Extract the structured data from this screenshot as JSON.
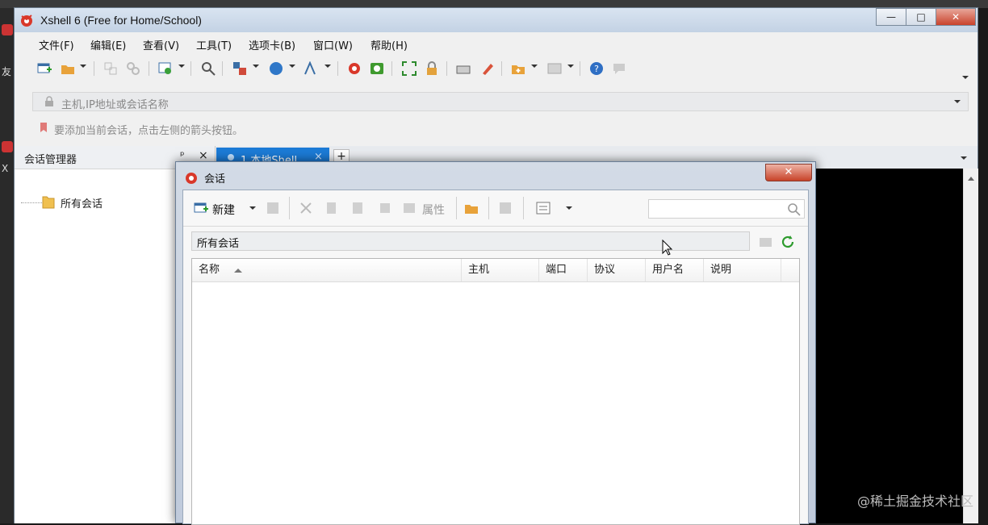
{
  "window": {
    "title": "Xshell 6 (Free for Home/School)",
    "minimize": "—",
    "maximize": "□",
    "close": "✕"
  },
  "desktop": {
    "icon_label_1": "友",
    "icon_label_2": "X"
  },
  "menus": [
    "文件(F)",
    "编辑(E)",
    "查看(V)",
    "工具(T)",
    "选项卡(B)",
    "窗口(W)",
    "帮助(H)"
  ],
  "address_bar": {
    "placeholder": "主机,IP地址或会话名称"
  },
  "tip_bar": {
    "text": "要添加当前会话，点击左侧的箭头按钮。"
  },
  "session_manager": {
    "title": "会话管理器",
    "tree_root": "所有会话",
    "pin": "ᵖ",
    "close": "×"
  },
  "tabs": [
    {
      "label": "1 本地Shell",
      "close": "×"
    }
  ],
  "tab_add": "+",
  "dialog": {
    "title": "会话",
    "close": "✕",
    "toolbar": {
      "new_label": "新建",
      "properties_label": "属性"
    },
    "path": "所有会话",
    "columns": [
      "名称",
      "主机",
      "端口",
      "协议",
      "用户名",
      "说明"
    ]
  },
  "watermark": "@稀土掘金技术社区",
  "colors": {
    "accent": "#1c7bd6",
    "close_red": "#c9432c",
    "terminal": "#000000"
  }
}
